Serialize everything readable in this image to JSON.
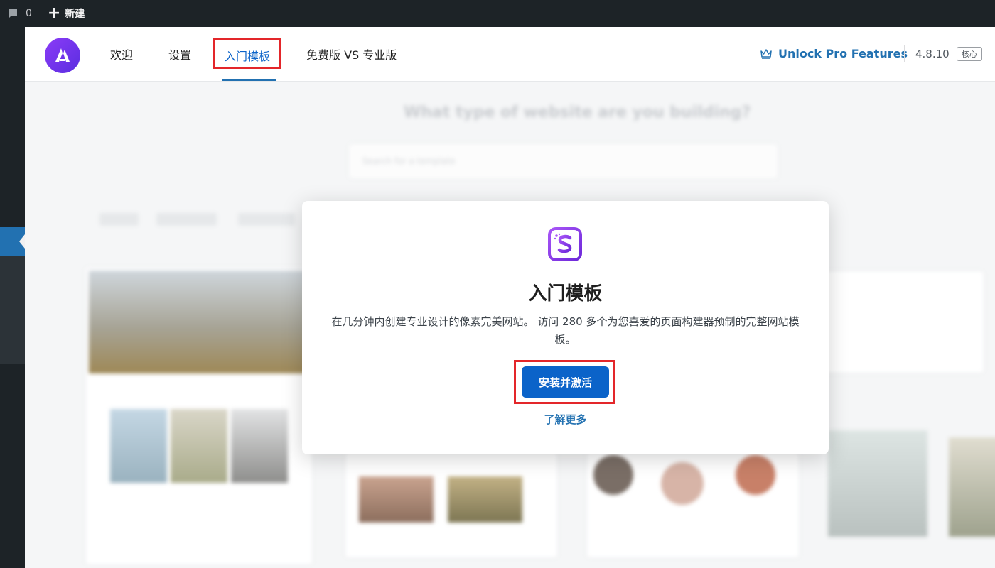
{
  "adminbar": {
    "comment_count": "0",
    "new_label": "新建"
  },
  "header": {
    "nav": {
      "welcome": "欢迎",
      "settings": "设置",
      "templates": "入门模板",
      "compare": "免费版 VS 专业版"
    },
    "pro_link": "Unlock Pro Features",
    "version": "4.8.10",
    "badge": "核心"
  },
  "background": {
    "title": "What type of website are you building?",
    "search_placeholder": "Search for a template"
  },
  "modal": {
    "title": "入门模板",
    "description": "在几分钟内创建专业设计的像素完美网站。 访问 280 多个为您喜爱的页面构建器预制的完整网站模板。",
    "button": "安装并激活",
    "link": "了解更多"
  },
  "colors": {
    "accent": "#0b63c9",
    "highlight": "#e3262a",
    "admin_dark": "#1d2327",
    "logo_purple": "#7b3aec"
  }
}
